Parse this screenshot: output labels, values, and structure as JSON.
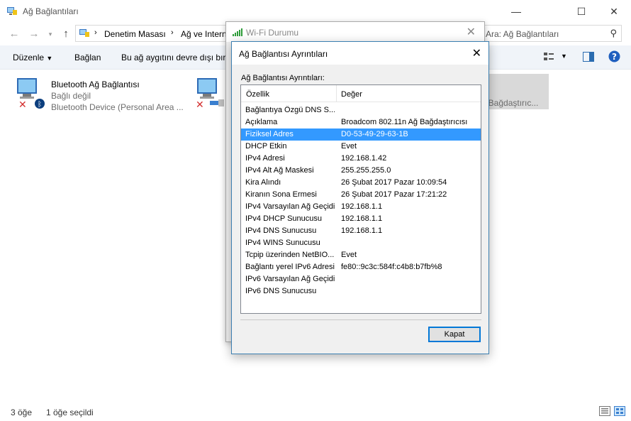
{
  "window": {
    "title": "Ağ Bağlantıları",
    "controls": {
      "minimize": "—",
      "maximize": "☐",
      "close": "✕"
    }
  },
  "address": {
    "crumbs": [
      "Denetim Masası",
      "Ağ ve Internet"
    ],
    "search_placeholder": "Ara: Ağ Bağlantıları"
  },
  "toolbar": {
    "organize": "Düzenle",
    "connect": "Bağlan",
    "disable": "Bu ağ aygıtını devre dışı bırak"
  },
  "items": [
    {
      "name": "Bluetooth Ağ Bağlantısı",
      "status": "Bağlı değil",
      "device": "Bluetooth Device (Personal Area ..."
    },
    {
      "name": "",
      "status": "",
      "device": ""
    }
  ],
  "selected_item_text": "ı Bağdaştırıc...",
  "statusbar": {
    "count": "3 öğe",
    "selected": "1 öğe seçildi"
  },
  "wifi_dialog": {
    "title": "Wi-Fi Durumu"
  },
  "details_dialog": {
    "title": "Ağ Bağlantısı Ayrıntıları",
    "caption": "Ağ Bağlantısı Ayrıntıları:",
    "col_property": "Özellik",
    "col_value": "Değer",
    "rows": [
      {
        "p": "Bağlantıya Özgü DNS S...",
        "v": ""
      },
      {
        "p": "Açıklama",
        "v": "Broadcom 802.11n Ağ Bağdaştırıcısı"
      },
      {
        "p": "Fiziksel Adres",
        "v": "D0-53-49-29-63-1B"
      },
      {
        "p": "DHCP Etkin",
        "v": "Evet"
      },
      {
        "p": "IPv4 Adresi",
        "v": "192.168.1.42"
      },
      {
        "p": "IPv4 Alt Ağ Maskesi",
        "v": "255.255.255.0"
      },
      {
        "p": "Kira Alındı",
        "v": "26 Şubat 2017 Pazar 10:09:54"
      },
      {
        "p": "Kiranın Sona Ermesi",
        "v": "26 Şubat 2017 Pazar 17:21:22"
      },
      {
        "p": "IPv4 Varsayılan Ağ Geçidi",
        "v": "192.168.1.1"
      },
      {
        "p": "IPv4 DHCP Sunucusu",
        "v": "192.168.1.1"
      },
      {
        "p": "IPv4 DNS Sunucusu",
        "v": "192.168.1.1"
      },
      {
        "p": "IPv4 WINS Sunucusu",
        "v": ""
      },
      {
        "p": "Tcpip üzerinden NetBIO...",
        "v": "Evet"
      },
      {
        "p": "Bağlantı yerel IPv6 Adresi",
        "v": "fe80::9c3c:584f:c4b8:b7fb%8"
      },
      {
        "p": "IPv6 Varsayılan Ağ Geçidi",
        "v": ""
      },
      {
        "p": "IPv6 DNS Sunucusu",
        "v": ""
      }
    ],
    "selected_row": 2,
    "close_button": "Kapat"
  }
}
